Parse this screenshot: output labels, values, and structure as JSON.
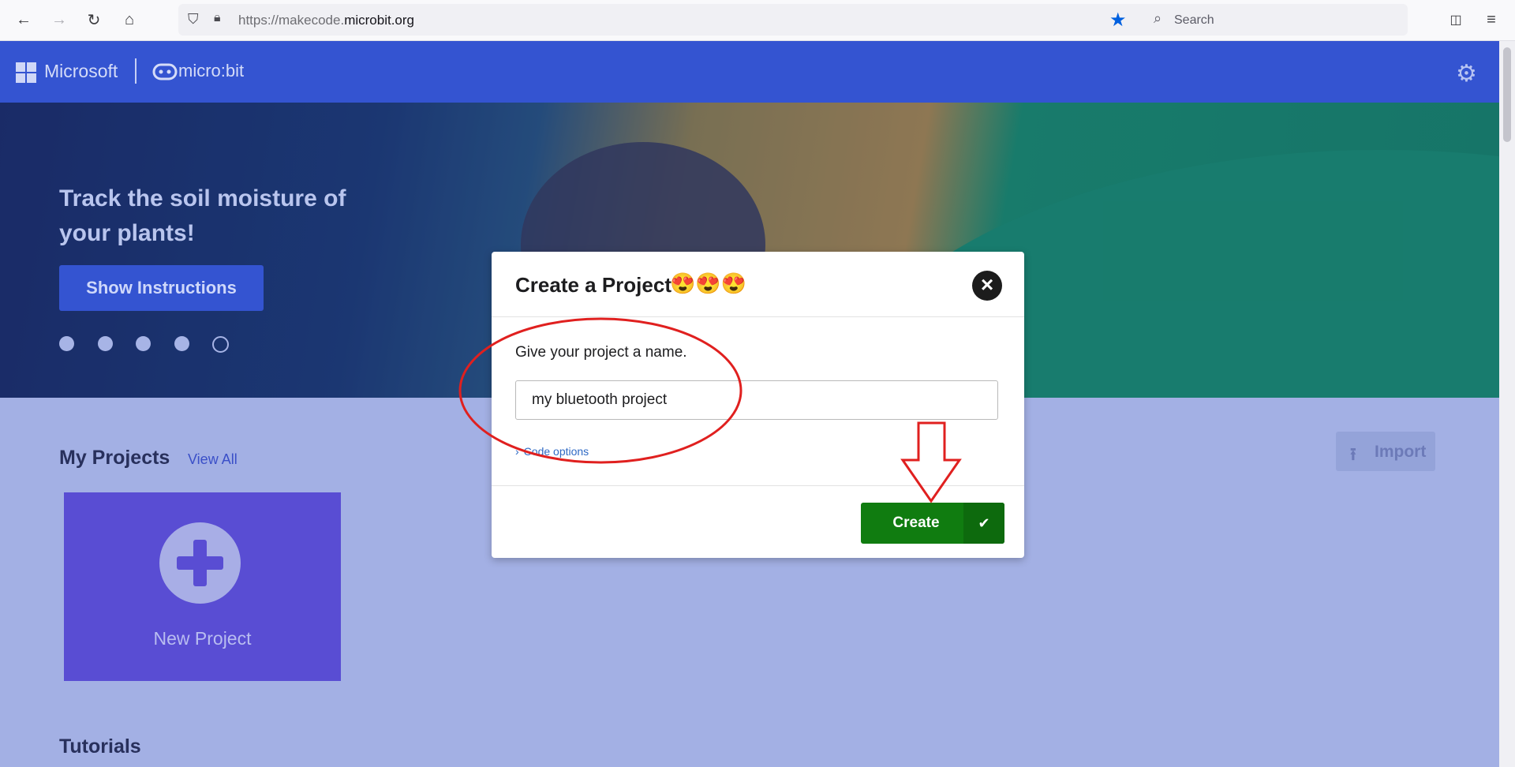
{
  "browser": {
    "url_prefix": "https://makecode.",
    "url_domain": "microbit.org",
    "search_placeholder": "Search"
  },
  "header": {
    "brand": "Microsoft",
    "product": "micro:bit"
  },
  "hero": {
    "title": "Track the soil moisture of your plants!",
    "button_label": "Show Instructions",
    "dots_total": 5,
    "active_dot": 5
  },
  "projects": {
    "title": "My Projects",
    "view_all": "View All",
    "import_label": "Import",
    "new_project_label": "New Project"
  },
  "tutorials": {
    "title": "Tutorials"
  },
  "dialog": {
    "title": "Create a Project",
    "emojis": "😍😍😍",
    "prompt": "Give your project a name.",
    "input_value": "my bluetooth project",
    "code_options": "Code options",
    "create_label": "Create"
  },
  "colors": {
    "header_blue": "#3454d1",
    "page_bg": "#a3b0e4",
    "create_green": "#107c10",
    "annotation_red": "#e0201f"
  }
}
